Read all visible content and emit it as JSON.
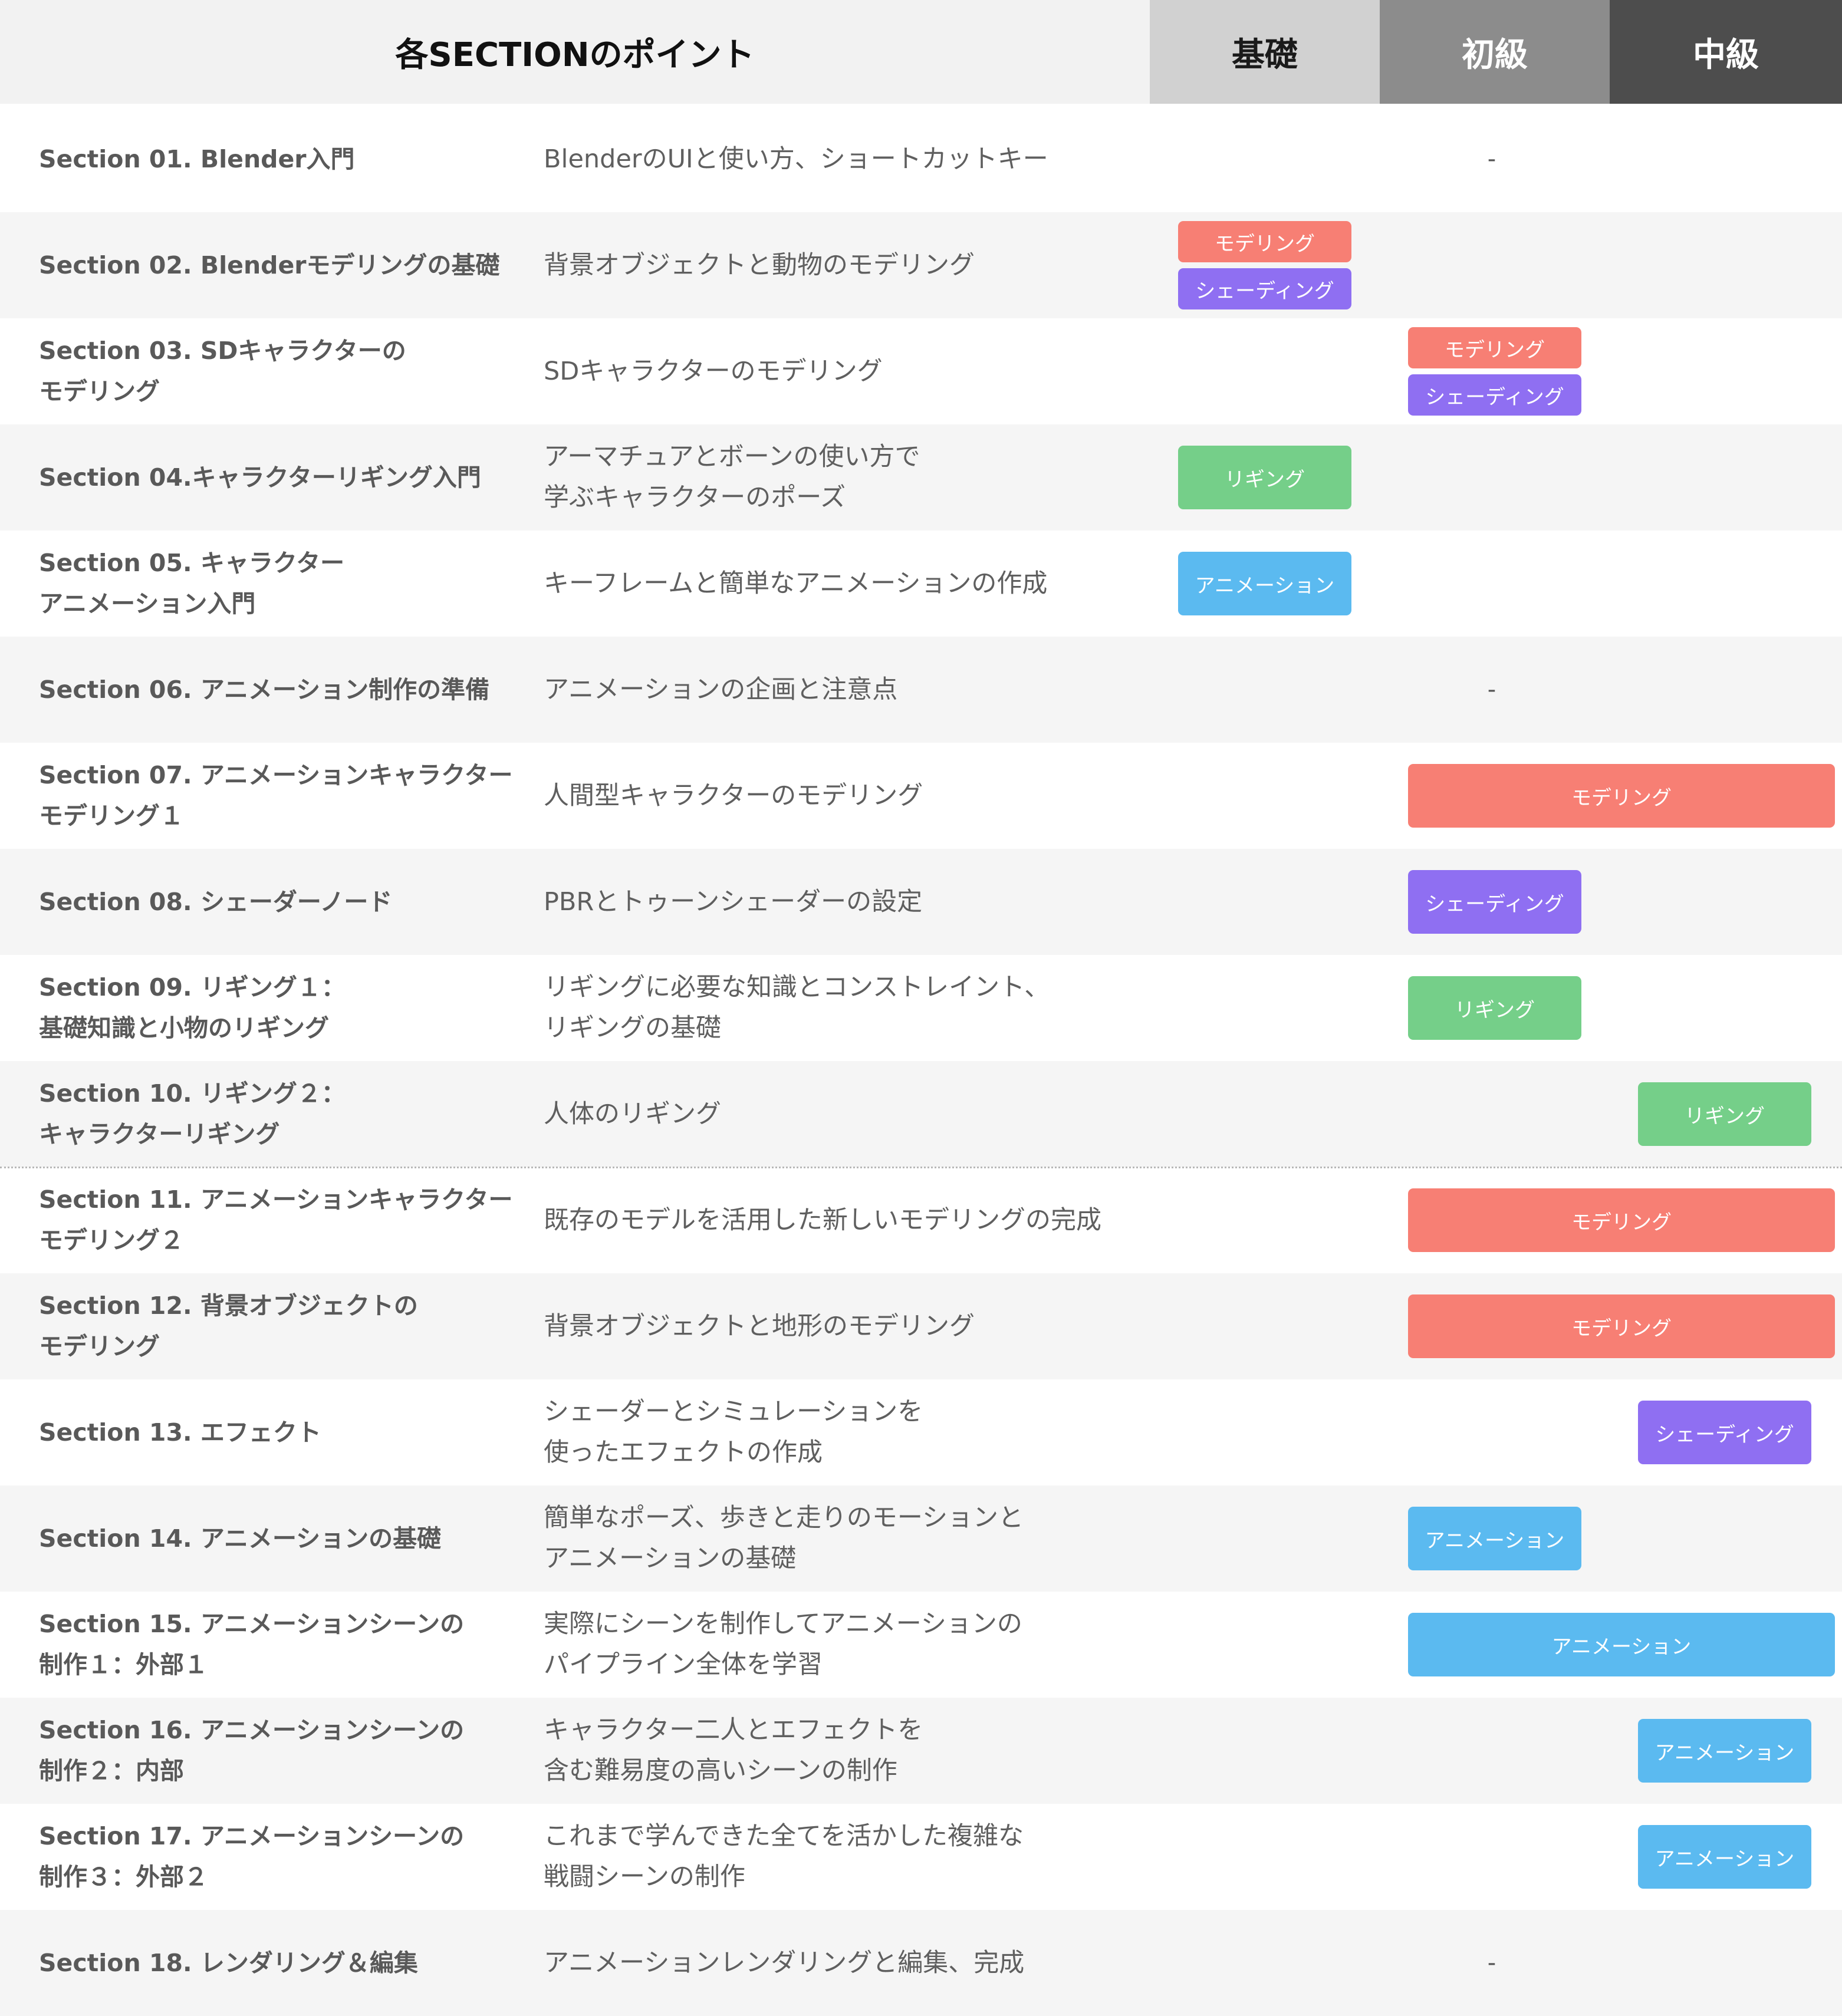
{
  "header": {
    "title": "各SECTIONのポイント",
    "levels": [
      "基礎",
      "初級",
      "中級"
    ]
  },
  "colors": {
    "modeling": "#f77f74",
    "shading": "#8f6ff2",
    "rigging": "#75cf89",
    "animation": "#5bbaf0",
    "level_basic_bg": "#d1d1d1",
    "level_beginner_bg": "#8c8c8c",
    "level_intermediate_bg": "#4d4d4d"
  },
  "tag_labels": {
    "modeling": "モデリング",
    "shading": "シェーディング",
    "rigging": "リギング",
    "animation": "アニメーション"
  },
  "rows": [
    {
      "title": [
        "Section 01. Blender入門"
      ],
      "desc": [
        "BlenderのUIと使い方、ショートカットキー"
      ],
      "dash": "-",
      "tags": []
    },
    {
      "title": [
        "Section 02. Blenderモデリングの基礎"
      ],
      "desc": [
        "背景オブジェクトと動物のモデリング"
      ],
      "tags": [
        {
          "type": "modeling",
          "levels": [
            "基礎"
          ]
        },
        {
          "type": "shading",
          "levels": [
            "基礎"
          ]
        }
      ]
    },
    {
      "title": [
        "Section 03. SDキャラクターの",
        "モデリング"
      ],
      "desc": [
        "SDキャラクターのモデリング"
      ],
      "tags": [
        {
          "type": "modeling",
          "levels": [
            "初級"
          ]
        },
        {
          "type": "shading",
          "levels": [
            "初級"
          ]
        }
      ]
    },
    {
      "title": [
        "Section 04.キャラクターリギング入門"
      ],
      "desc": [
        "アーマチュアとボーンの使い方で",
        "学ぶキャラクターのポーズ"
      ],
      "tags": [
        {
          "type": "rigging",
          "levels": [
            "基礎"
          ]
        }
      ]
    },
    {
      "title": [
        "Section 05. キャラクター",
        "アニメーション入門"
      ],
      "desc": [
        "キーフレームと簡単なアニメーションの作成"
      ],
      "tags": [
        {
          "type": "animation",
          "levels": [
            "基礎"
          ]
        }
      ]
    },
    {
      "title": [
        "Section 06. アニメーション制作の準備"
      ],
      "desc": [
        "アニメーションの企画と注意点"
      ],
      "dash": "-",
      "tags": []
    },
    {
      "title": [
        "Section 07. アニメーションキャラクター",
        "モデリング１"
      ],
      "desc": [
        "人間型キャラクターのモデリング"
      ],
      "tags": [
        {
          "type": "modeling",
          "levels": [
            "初級",
            "中級"
          ]
        }
      ]
    },
    {
      "title": [
        "Section 08. シェーダーノード"
      ],
      "desc": [
        "PBRとトゥーンシェーダーの設定"
      ],
      "tags": [
        {
          "type": "shading",
          "levels": [
            "初級"
          ]
        }
      ]
    },
    {
      "title": [
        "Section 09. リギング１：",
        "基礎知識と小物のリギング"
      ],
      "desc": [
        "リギングに必要な知識とコンストレイント、",
        "リギングの基礎"
      ],
      "tags": [
        {
          "type": "rigging",
          "levels": [
            "初級"
          ]
        }
      ]
    },
    {
      "title": [
        "Section 10. リギング２：",
        "キャラクターリギング"
      ],
      "desc": [
        "人体のリギング"
      ],
      "tags": [
        {
          "type": "rigging",
          "levels": [
            "中級"
          ]
        }
      ]
    },
    {
      "title": [
        "Section 11. アニメーションキャラクター",
        "モデリング２"
      ],
      "desc": [
        "既存のモデルを活用した新しいモデリングの完成"
      ],
      "tags": [
        {
          "type": "modeling",
          "levels": [
            "初級",
            "中級"
          ]
        }
      ]
    },
    {
      "title": [
        "Section 12. 背景オブジェクトの",
        "モデリング"
      ],
      "desc": [
        "背景オブジェクトと地形のモデリング"
      ],
      "tags": [
        {
          "type": "modeling",
          "levels": [
            "初級",
            "中級"
          ]
        }
      ]
    },
    {
      "title": [
        "Section 13. エフェクト"
      ],
      "desc": [
        "シェーダーとシミュレーションを",
        "使ったエフェクトの作成"
      ],
      "tags": [
        {
          "type": "shading",
          "levels": [
            "中級"
          ]
        }
      ]
    },
    {
      "title": [
        "Section 14. アニメーションの基礎"
      ],
      "desc": [
        "簡単なポーズ、歩きと走りのモーションと",
        "アニメーションの基礎"
      ],
      "tags": [
        {
          "type": "animation",
          "levels": [
            "初級"
          ]
        }
      ]
    },
    {
      "title": [
        "Section 15. アニメーションシーンの",
        "制作１：外部１"
      ],
      "desc": [
        "実際にシーンを制作してアニメーションの",
        "パイプライン全体を学習"
      ],
      "tags": [
        {
          "type": "animation",
          "levels": [
            "初級",
            "中級"
          ]
        }
      ]
    },
    {
      "title": [
        "Section 16. アニメーションシーンの",
        "制作２：内部"
      ],
      "desc": [
        "キャラクター二人とエフェクトを",
        "含む難易度の高いシーンの制作"
      ],
      "tags": [
        {
          "type": "animation",
          "levels": [
            "中級"
          ]
        }
      ]
    },
    {
      "title": [
        "Section 17. アニメーションシーンの",
        "制作３：外部２"
      ],
      "desc": [
        "これまで学んできた全てを活かした複雑な",
        "戦闘シーンの制作"
      ],
      "tags": [
        {
          "type": "animation",
          "levels": [
            "中級"
          ]
        }
      ]
    },
    {
      "title": [
        "Section 18. レンダリング＆編集"
      ],
      "desc": [
        "アニメーションレンダリングと編集、完成"
      ],
      "dash": "-",
      "tags": []
    }
  ]
}
